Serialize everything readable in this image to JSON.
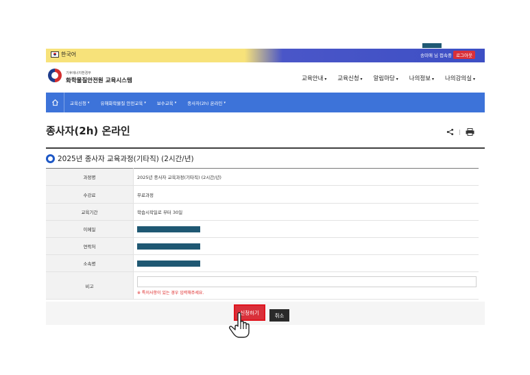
{
  "topbar": {
    "lang_label": "한국어",
    "user_info": "송미애 님 접속중",
    "logout_label": "로그아웃"
  },
  "header": {
    "ministry": "기후에너지환경부",
    "site_name": "화학물질안전원 교육시스템",
    "nav": [
      "교육안내",
      "교육신청",
      "알림마당",
      "나의정보",
      "나의강의실"
    ]
  },
  "subnav": {
    "items": [
      "교육신청",
      "유해화학물질 안전교육",
      "보수교육",
      "종사자(2h) 온라인"
    ]
  },
  "page": {
    "title": "종사자(2h) 온라인",
    "course_title": "2025년 종사자 교육과정(기타직) (2시간/년)"
  },
  "form": {
    "course_label": "과정명",
    "course_value": "2025년 종사자 교육과정(기타직) (2시간/년)",
    "fee_label": "수강료",
    "fee_value": "무료과정",
    "period_label": "교육기간",
    "period_value": "학습시작일로 부터 30일",
    "email_label": "이메일",
    "phone_label": "연락처",
    "org_label": "소속명",
    "note_label": "비고",
    "note_help": "※ 특이사항이 있는 경우 입력해주세요."
  },
  "buttons": {
    "apply": "신청하기",
    "cancel": "취소"
  }
}
